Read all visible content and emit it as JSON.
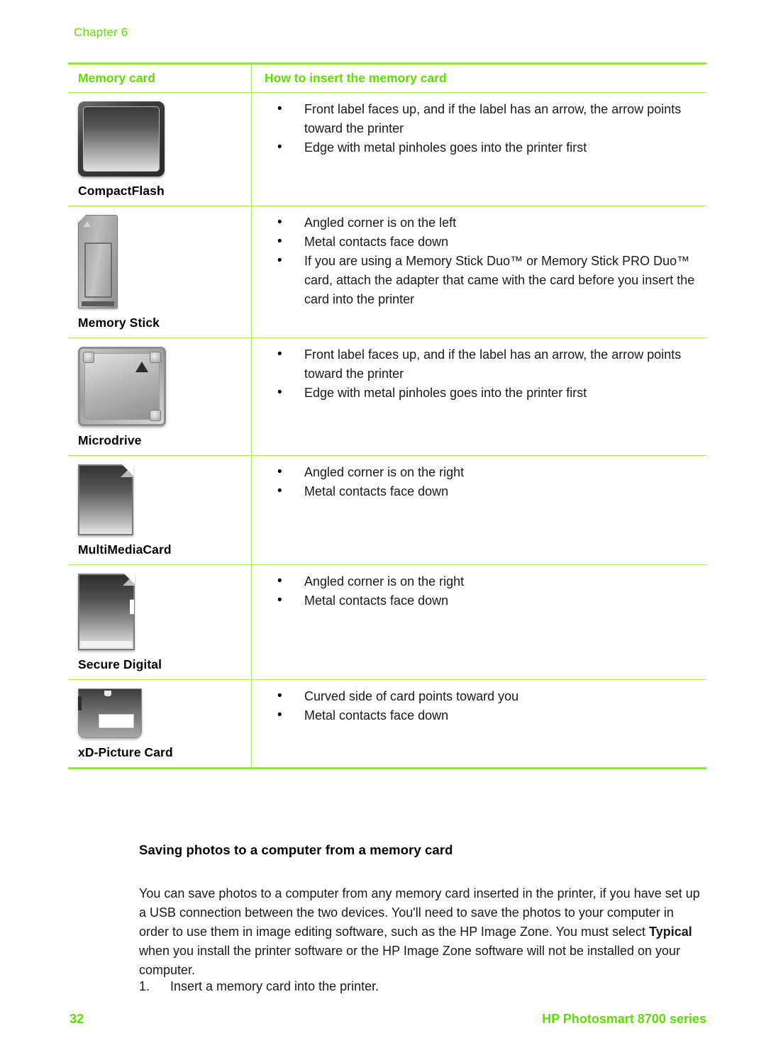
{
  "header": {
    "chapter_label": "Chapter 6"
  },
  "colors": {
    "accent_green": "#5FDD00",
    "border_green": "#8CE849",
    "rule_green": "#A6EE70",
    "text_black": "#000000"
  },
  "table": {
    "columns": [
      {
        "header": "Memory card"
      },
      {
        "header": "How to insert the memory card"
      }
    ],
    "rows": [
      {
        "card_name": "CompactFlash",
        "icon": "compactflash-card-icon",
        "bullets": [
          "Front label faces up, and if the label has an arrow, the arrow points toward the printer",
          "Edge with metal pinholes goes into the printer first"
        ]
      },
      {
        "card_name": "Memory Stick",
        "icon": "memory-stick-card-icon",
        "bullets": [
          "Angled corner is on the left",
          "Metal contacts face down"
        ],
        "bullet_rich": "If you are using a Memory Stick Duo™ or Memory Stick PRO Duo™ card, attach the adapter that came with the card before you insert the card into the printer"
      },
      {
        "card_name": "Microdrive",
        "icon": "microdrive-card-icon",
        "bullets": [
          "Front label faces up, and if the label has an arrow, the arrow points toward the printer",
          "Edge with metal pinholes goes into the printer first"
        ]
      },
      {
        "card_name": "MultiMediaCard",
        "icon": "multimediacard-icon",
        "bullets": [
          "Angled corner is on the right",
          "Metal contacts face down"
        ]
      },
      {
        "card_name": "Secure Digital",
        "icon": "secure-digital-card-icon",
        "bullets": [
          "Angled corner is on the right",
          "Metal contacts face down"
        ]
      },
      {
        "card_name": "xD-Picture Card",
        "icon": "xd-picture-card-icon",
        "bullets": [
          "Curved side of card points toward you",
          "Metal contacts face down"
        ]
      }
    ]
  },
  "section": {
    "heading": "Saving photos to a computer from a memory card",
    "paragraph_part1": "You can save photos to a computer from any memory card inserted in the printer, if you have set up a USB connection between the two devices. You'll need to save the photos to your computer in order to use them in image editing software, such as the HP Image Zone. You must select ",
    "paragraph_emphasis": "Typical",
    "paragraph_part2": " when you install the printer software or the HP Image Zone software will not be installed on your computer.",
    "step_number": "1.",
    "step_text": "Insert a memory card into the printer."
  },
  "footer": {
    "page_number": "32",
    "product_name": "HP Photosmart 8700 series"
  }
}
